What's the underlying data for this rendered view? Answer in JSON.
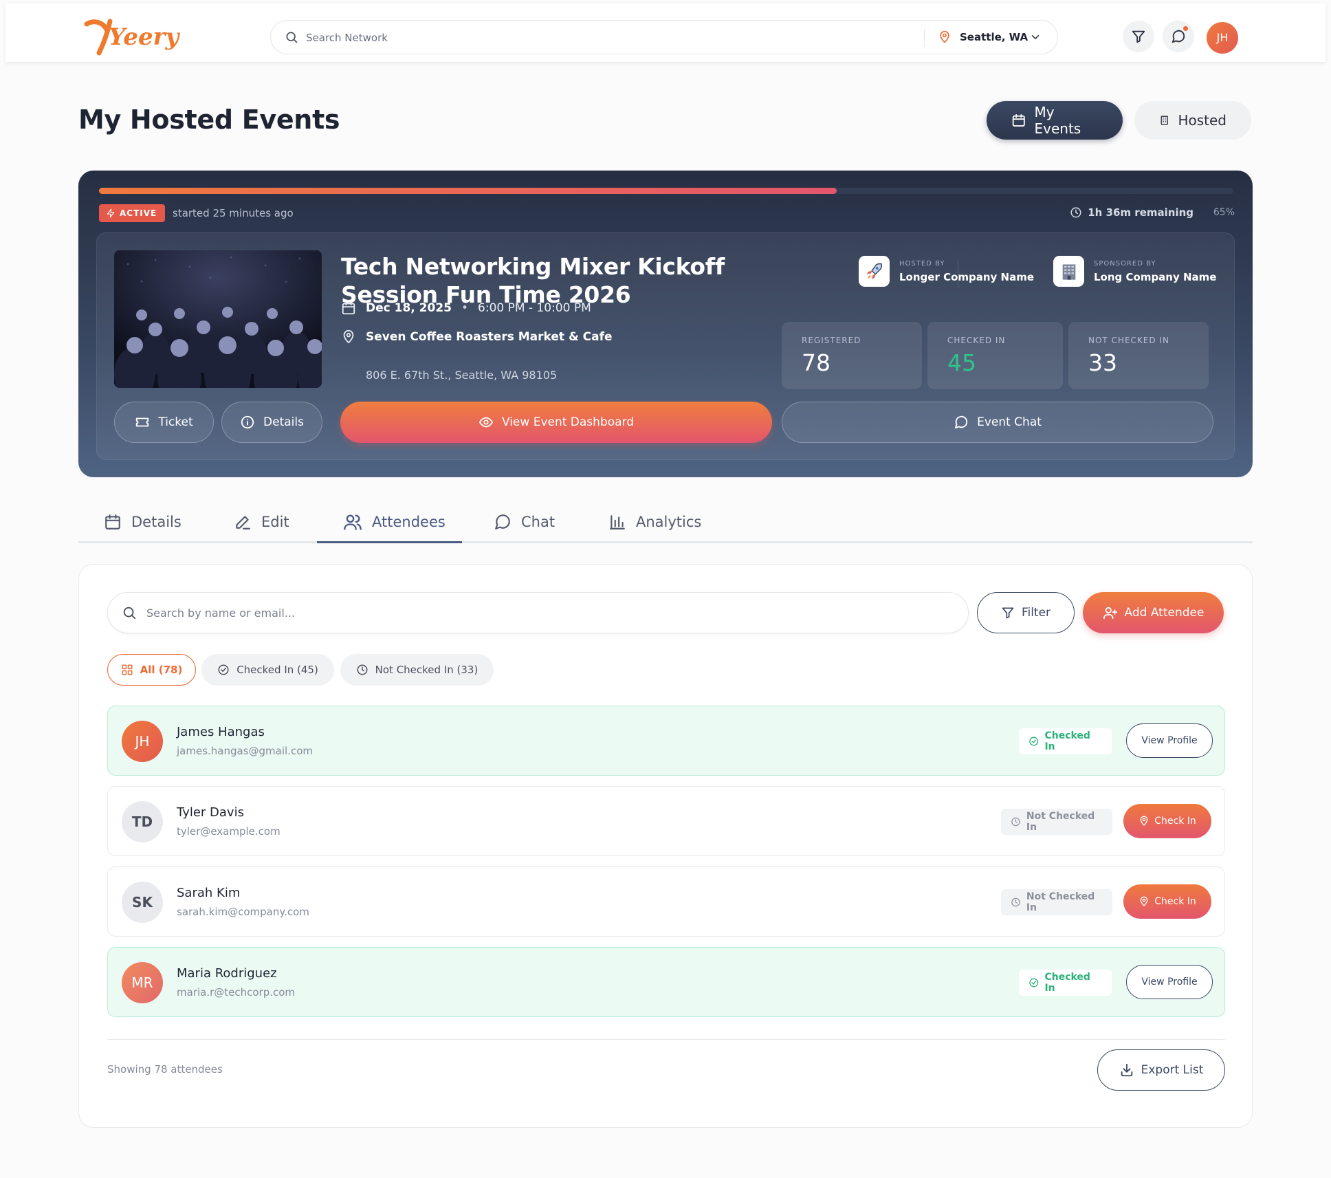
{
  "header": {
    "logo_text": "Yeery",
    "search_placeholder": "Search Network",
    "location": "Seattle, WA",
    "user_initials": "JH"
  },
  "page": {
    "title": "My Hosted Events",
    "segments": [
      "My Events",
      "Hosted"
    ]
  },
  "event": {
    "status": "ACTIVE",
    "started": "started 25 minutes ago",
    "remaining": "1h 36m remaining",
    "progress_label": "65%",
    "progress": 0.65,
    "title": "Tech Networking Mixer Kickoff Session Fun Time 2026",
    "date": "Dec 18, 2025",
    "time": "6:00 PM - 10:00 PM",
    "venue": "Seven Coffee Roasters Market & Cafe",
    "address": "806 E. 67th St., Seattle, WA 98105",
    "host_caption": "HOSTED BY",
    "host_name": "Longer Company Name",
    "sponsor_caption": "SPONSORED BY",
    "sponsor_name": "Long Company Name",
    "stats": [
      {
        "label": "REGISTERED",
        "value": "78"
      },
      {
        "label": "CHECKED IN",
        "value": "45"
      },
      {
        "label": "NOT CHECKED IN",
        "value": "33"
      }
    ],
    "buttons": {
      "ticket": "Ticket",
      "details": "Details",
      "dashboard": "View Event Dashboard",
      "chat": "Event Chat"
    }
  },
  "tabs": [
    "Details",
    "Edit",
    "Attendees",
    "Chat",
    "Analytics"
  ],
  "attendees": {
    "search_placeholder": "Search by name or email...",
    "filter": "Filter",
    "add": "Add Attendee",
    "chips": [
      "All (78)",
      "Checked In (45)",
      "Not Checked In (33)"
    ],
    "rows": [
      {
        "initials": "JH",
        "name": "James Hangas",
        "email": "james.hangas@gmail.com",
        "status": "Checked In",
        "action": "View Profile"
      },
      {
        "initials": "TD",
        "name": "Tyler Davis",
        "email": "tyler@example.com",
        "status": "Not Checked In",
        "action": "Check In"
      },
      {
        "initials": "SK",
        "name": "Sarah Kim",
        "email": "sarah.kim@company.com",
        "status": "Not Checked In",
        "action": "Check In"
      },
      {
        "initials": "MR",
        "name": "Maria Rodriguez",
        "email": "maria.r@techcorp.com",
        "status": "Checked In",
        "action": "View Profile"
      }
    ],
    "footer": "Showing 78 attendees",
    "export": "Export List"
  },
  "colors": {
    "accent": "#ef6b36",
    "navy": "#3b4863",
    "success": "#2bb17a"
  }
}
